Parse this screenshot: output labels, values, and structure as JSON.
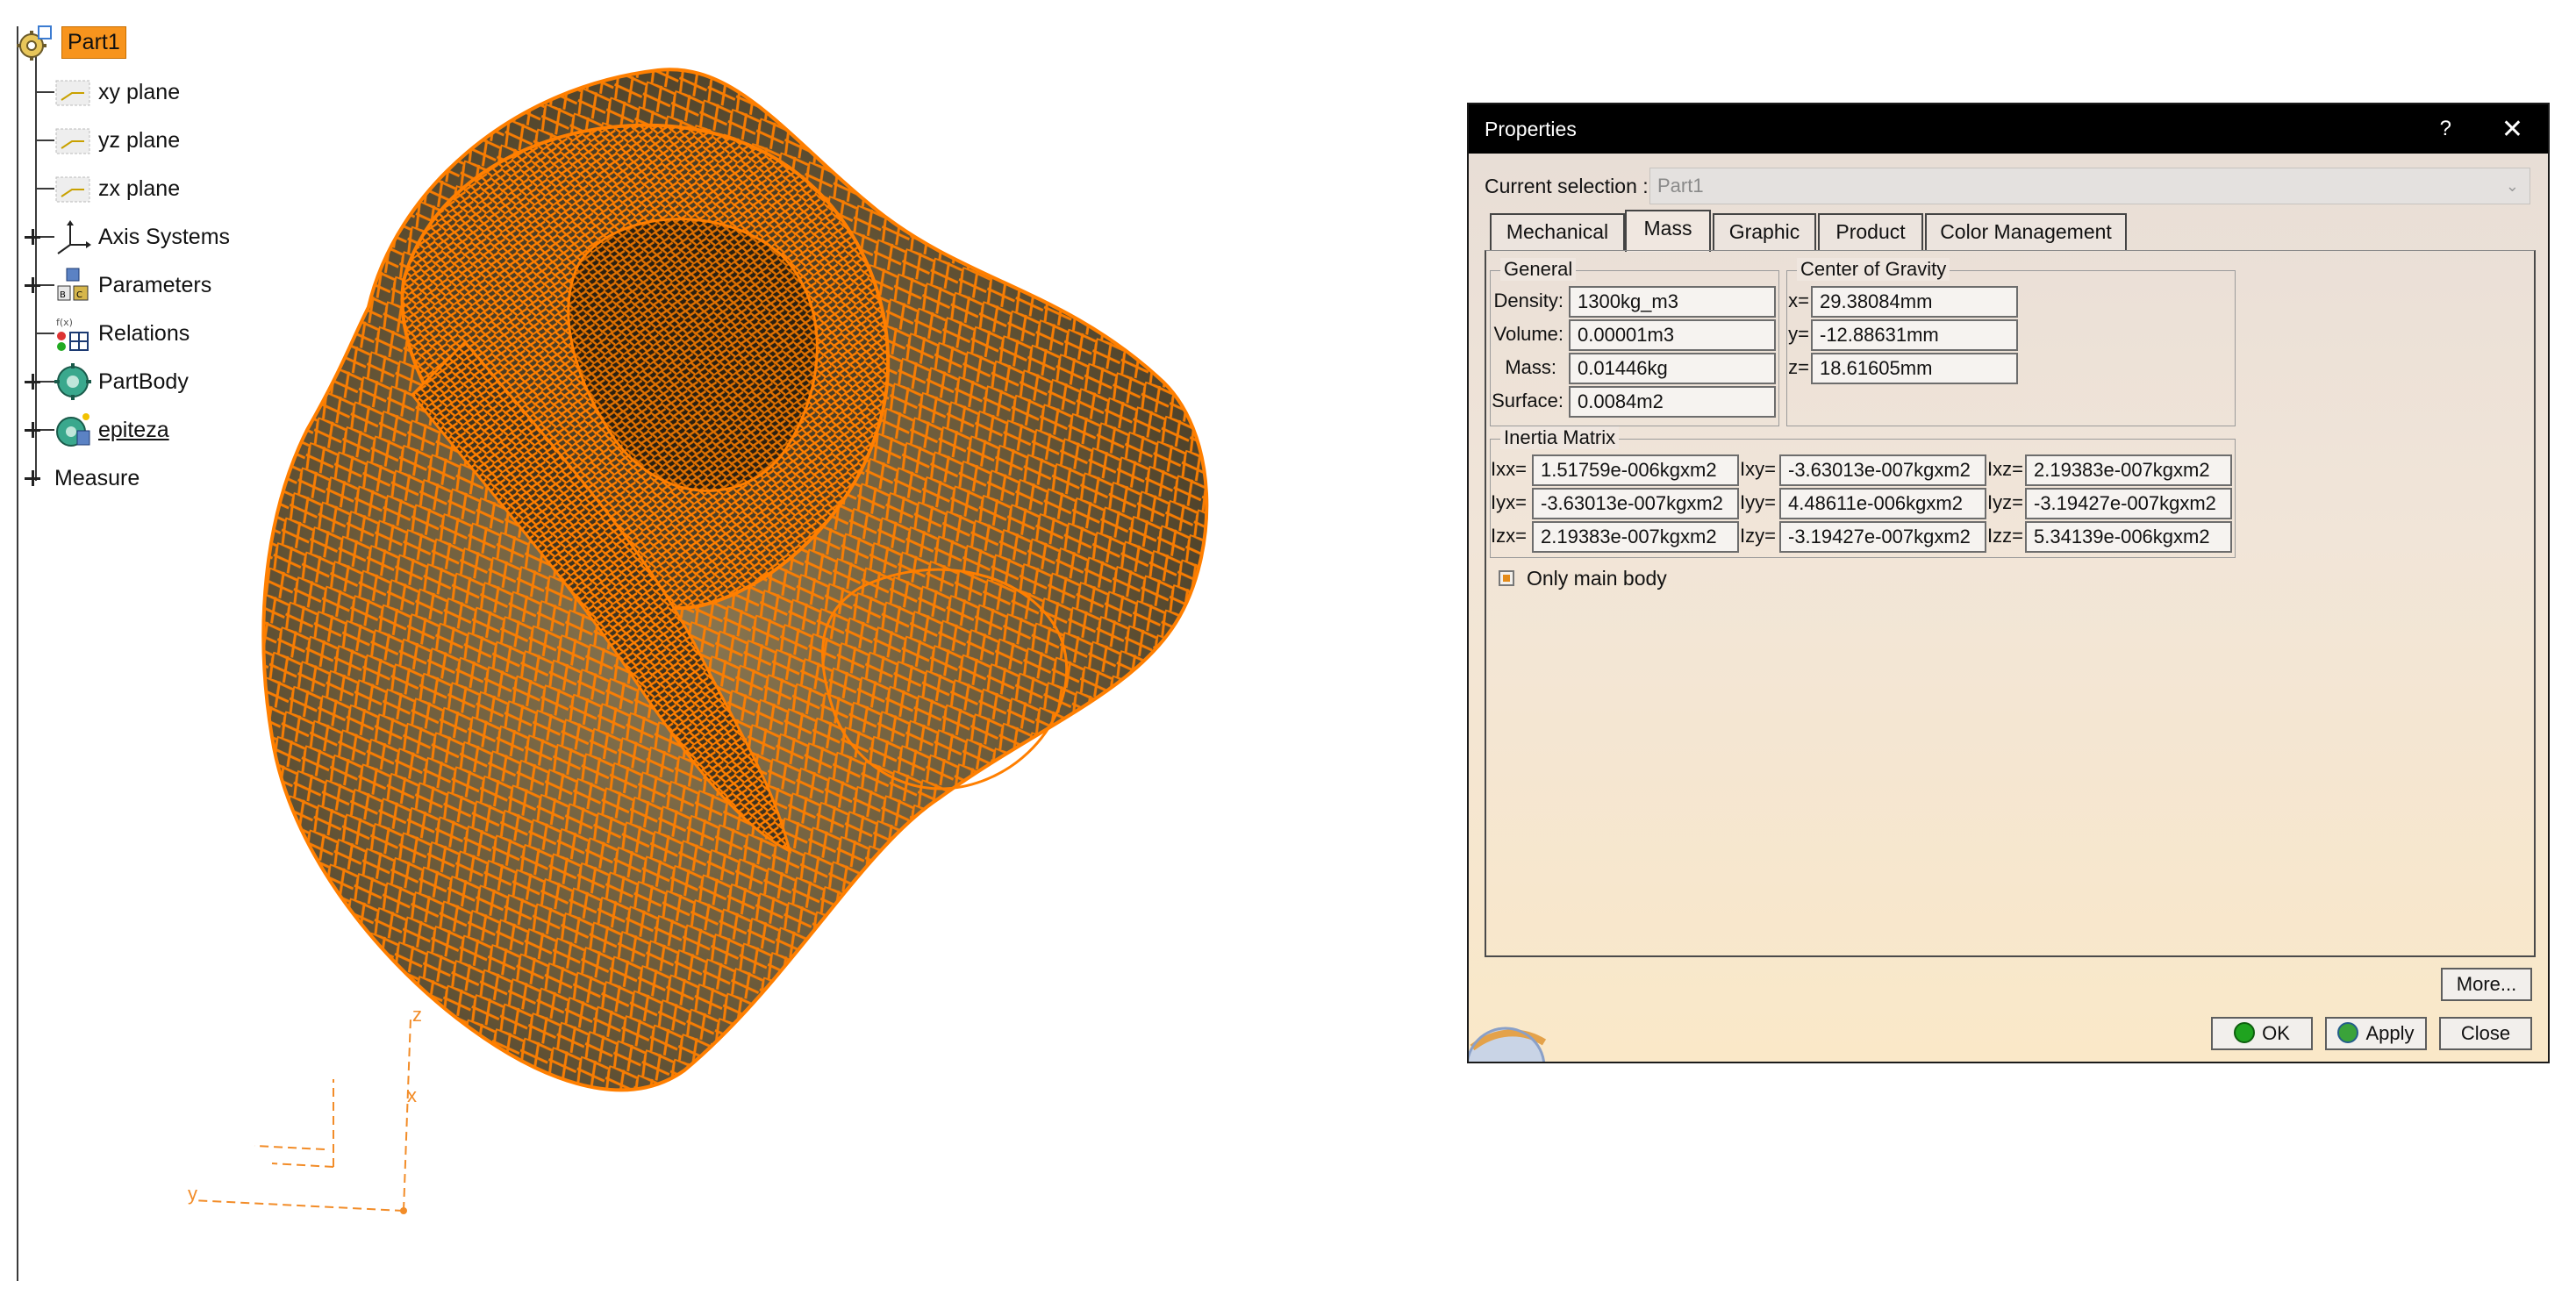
{
  "tree": {
    "root": "Part1",
    "items": [
      {
        "label": "xy plane",
        "icon": "plane-icon",
        "expandable": false
      },
      {
        "label": "yz plane",
        "icon": "plane-icon",
        "expandable": false
      },
      {
        "label": "zx plane",
        "icon": "plane-icon",
        "expandable": false
      },
      {
        "label": "Axis Systems",
        "icon": "axis-system-icon",
        "expandable": true
      },
      {
        "label": "Parameters",
        "icon": "parameters-icon",
        "expandable": true
      },
      {
        "label": "Relations",
        "icon": "relations-icon",
        "expandable": false
      },
      {
        "label": "PartBody",
        "icon": "partbody-icon",
        "expandable": true
      },
      {
        "label": "epiteza",
        "icon": "geometrical-set-icon",
        "expandable": true
      }
    ],
    "measure": "Measure"
  },
  "viewport": {
    "axis_labels": {
      "z": "z",
      "x": "x",
      "y": "y"
    },
    "colors": {
      "mesh": "#ff7f00",
      "surface": "#6b5a3a"
    }
  },
  "dialog": {
    "title": "Properties",
    "help": "?",
    "close_glyph": "✕",
    "current_selection_label": "Current selection :",
    "current_selection_value": "Part1",
    "tabs": [
      "Mechanical",
      "Mass",
      "Graphic",
      "Product",
      "Color Management"
    ],
    "active_tab": "Mass",
    "general": {
      "title": "General",
      "density_label": "Density:",
      "density": "1300kg_m3",
      "volume_label": "Volume:",
      "volume": "0.00001m3",
      "mass_label": "Mass:",
      "mass": "0.01446kg",
      "surface_label": "Surface:",
      "surface": "0.0084m2"
    },
    "cog": {
      "title": "Center of Gravity",
      "x_label": "x=",
      "x": "29.38084mm",
      "y_label": "y=",
      "y": "-12.88631mm",
      "z_label": "z=",
      "z": "18.61605mm"
    },
    "inertia": {
      "title": "Inertia Matrix",
      "ixx_label": "Ixx=",
      "ixx": "1.51759e-006kgxm2",
      "ixy_label": "Ixy=",
      "ixy": "-3.63013e-007kgxm2",
      "ixz_label": "Ixz=",
      "ixz": "2.19383e-007kgxm2",
      "iyx_label": "Iyx=",
      "iyx": "-3.63013e-007kgxm2",
      "iyy_label": "Iyy=",
      "iyy": "4.48611e-006kgxm2",
      "iyz_label": "Iyz=",
      "iyz": "-3.19427e-007kgxm2",
      "izx_label": "Izx=",
      "izx": "2.19383e-007kgxm2",
      "izy_label": "Izy=",
      "izy": "-3.19427e-007kgxm2",
      "izz_label": "Izz=",
      "izz": "5.34139e-006kgxm2"
    },
    "only_main_body": "Only main body",
    "buttons": {
      "more": "More...",
      "ok": "OK",
      "apply": "Apply",
      "close": "Close"
    }
  }
}
